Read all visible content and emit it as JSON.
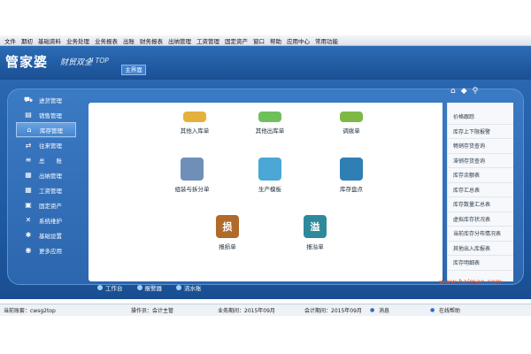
{
  "menu": [
    "文件",
    "期初",
    "基础资料",
    "业务处理",
    "业务报表",
    "出账",
    "财务报表",
    "出纳管理",
    "工资管理",
    "固定资产",
    "窗口",
    "帮助",
    "应用中心",
    "常用功能"
  ],
  "header": {
    "logo": "管家婆",
    "subtitle": "财贸双全",
    "version": "II TOP",
    "main_tab": "主界面"
  },
  "sidebar": [
    {
      "label": "进货管理",
      "icon": "cart-icon"
    },
    {
      "label": "销售管理",
      "icon": "chart-icon"
    },
    {
      "label": "库存管理",
      "icon": "warehouse-icon",
      "active": true
    },
    {
      "label": "往来管理",
      "icon": "exchange-icon"
    },
    {
      "label": "总　　账",
      "icon": "ledger-icon"
    },
    {
      "label": "出纳管理",
      "icon": "cashier-icon"
    },
    {
      "label": "工资管理",
      "icon": "grid-icon"
    },
    {
      "label": "固定资产",
      "icon": "asset-icon"
    },
    {
      "label": "系统维护",
      "icon": "tools-icon"
    },
    {
      "label": "基础设置",
      "icon": "gear-icon"
    },
    {
      "label": "更多应用",
      "icon": "more-icon"
    }
  ],
  "tiles": [
    {
      "label": "其他入库单",
      "icon": "inbound-icon",
      "color": "#e6b13a"
    },
    {
      "label": "其他出库单",
      "icon": "outbound-icon",
      "color": "#6fbf5a"
    },
    {
      "label": "调拨单",
      "icon": "transfer-icon",
      "color": "#7fb845"
    },
    {
      "label": "组装与拆分单",
      "icon": "assembly-icon",
      "color": "#6f8fb8"
    },
    {
      "label": "生产模板",
      "icon": "production-icon",
      "color": "#4aa7d6"
    },
    {
      "label": "库存盘点",
      "icon": "stocktake-icon",
      "color": "#2f7fb5"
    },
    {
      "label": "报损单",
      "icon": "loss-icon",
      "color": "#b06a2a",
      "glyph": "损"
    },
    {
      "label": "报溢单",
      "icon": "overflow-icon",
      "color": "#2e8a9a",
      "glyph": "溢"
    }
  ],
  "rightlist": [
    "价格跟踪",
    "库存上下限报警",
    "畅销存货查询",
    "滞销存货查询",
    "库存余额表",
    "库存汇总表",
    "库存数量汇总表",
    "虚拟库存状况表",
    "当前库存分布情况表",
    "其他出入库报表",
    "库存明细表"
  ],
  "bottom_tabs": [
    "工作台",
    "报警器",
    "流水账"
  ],
  "watermark": "www.baimao.com",
  "status": {
    "account": "当前账套：cwsg2top",
    "operator": "操作员：会计主管",
    "period": "业务期间：2015年09月",
    "acc_period": "会计期间：2015年09月",
    "message": "消息",
    "help": "在线帮助"
  }
}
